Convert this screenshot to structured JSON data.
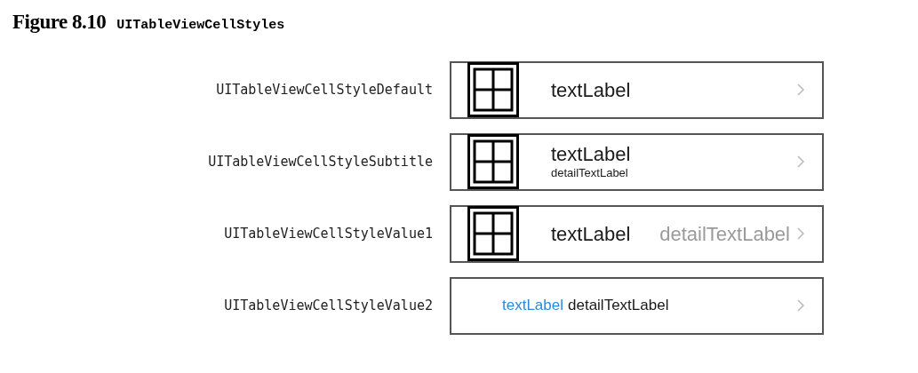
{
  "figure": {
    "number": "Figure 8.10",
    "title": "UITableViewCellStyles"
  },
  "rows": [
    {
      "style_name": "UITableViewCellStyleDefault",
      "kind": "default",
      "text_label": "textLabel"
    },
    {
      "style_name": "UITableViewCellStyleSubtitle",
      "kind": "subtitle",
      "text_label": "textLabel",
      "detail_label": "detailTextLabel"
    },
    {
      "style_name": "UITableViewCellStyleValue1",
      "kind": "value1",
      "text_label": "textLabel",
      "detail_label": "detailTextLabel"
    },
    {
      "style_name": "UITableViewCellStyleValue2",
      "kind": "value2",
      "text_label": "textLabel",
      "detail_label": "detailTextLabel"
    }
  ]
}
